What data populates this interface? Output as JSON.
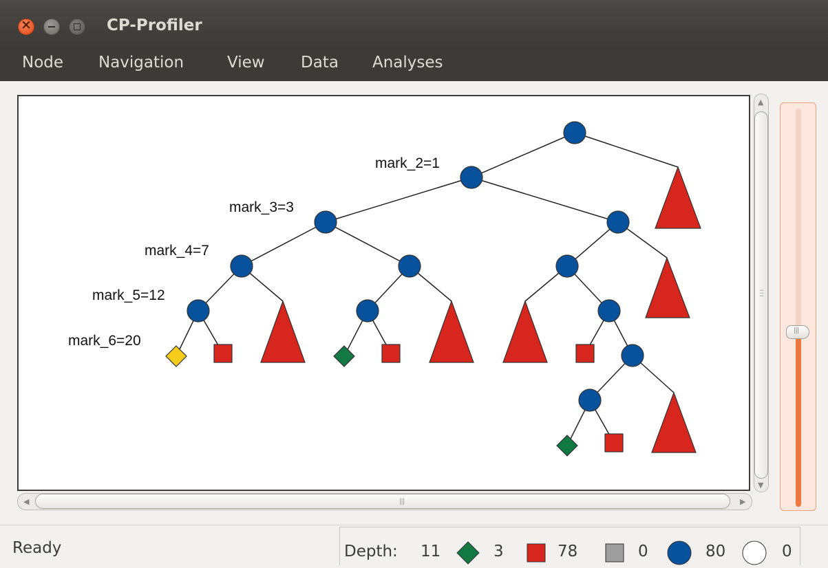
{
  "window": {
    "title": "CP-Profiler"
  },
  "menu": [
    "Node",
    "Navigation",
    "View",
    "Data",
    "Analyses"
  ],
  "tree": {
    "colors": {
      "branch_node": "#08519c",
      "failed_node": "#d7261e",
      "failed_subtree": "#d7261e",
      "solution": "#137944",
      "best_solution": "#f8cc1b",
      "undetermined": "#9e9e9e"
    },
    "labels": [
      "mark_2=1",
      "mark_3=3",
      "mark_4=7",
      "mark_5=12",
      "mark_6=20"
    ]
  },
  "status": {
    "text": "Ready"
  },
  "stats": {
    "depth_label": "Depth:",
    "depth": "11",
    "solutions": "3",
    "failures": "78",
    "undetermined": "0",
    "branches": "80",
    "open": "0"
  },
  "slider": {
    "level": 0.43
  }
}
